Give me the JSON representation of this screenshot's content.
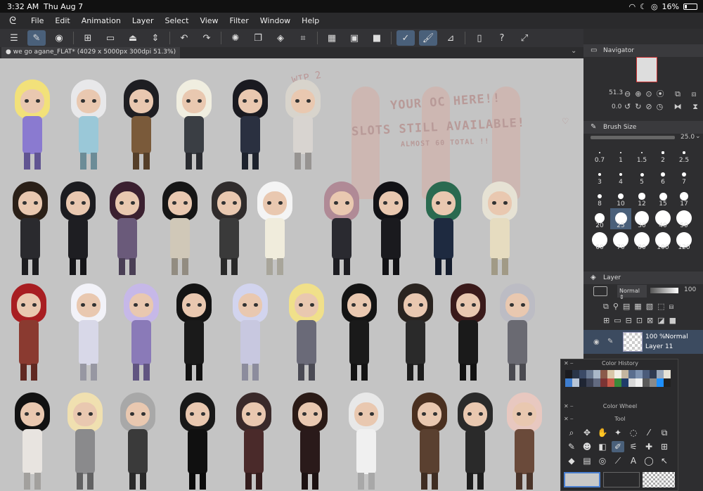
{
  "status": {
    "time": "3:32 AM",
    "date": "Thu Aug 7",
    "battery": "16%"
  },
  "menu": {
    "items": [
      "File",
      "Edit",
      "Animation",
      "Layer",
      "Select",
      "View",
      "Filter",
      "Window",
      "Help"
    ]
  },
  "document": {
    "tab_title": "we go agane_FLAT* (4029 x 5000px 300dpi 51.3%)"
  },
  "canvas_text": {
    "wip": "WIP 2",
    "line1": "YOUR OC HERE!!",
    "line2": "SLOTS STILL AVAILABLE!",
    "line3": "ALMOST 60 TOTAL !!"
  },
  "navigator": {
    "title": "Navigator",
    "zoom": "51.3",
    "rotation": "0.0"
  },
  "brush": {
    "title": "Brush Size",
    "value": "25.0",
    "sizes": [
      "0.7",
      "1",
      "1.5",
      "2",
      "2.5",
      "3",
      "4",
      "5",
      "6",
      "7",
      "8",
      "10",
      "12",
      "15",
      "17",
      "20",
      "25",
      "30",
      "40",
      "50",
      "60",
      "70",
      "80",
      "100",
      "120"
    ],
    "selected": "25"
  },
  "layer": {
    "title": "Layer",
    "blend": "Normal",
    "opacity": "100",
    "row_opacity": "100 %",
    "row_blend": "Normal",
    "row_name": "Layer 11"
  },
  "float": {
    "color_history": "Color History",
    "color_wheel": "Color Wheel",
    "tool": "Tool"
  },
  "colors": {
    "history": [
      "#1b1b1f",
      "#2a3548",
      "#3b4a66",
      "#6b7a92",
      "#aab8c8",
      "#8b5a4a",
      "#d9c7a8",
      "#f2efe6",
      "#c4b6a0",
      "#5a6e8e",
      "#7d92b0",
      "#4b5c7a",
      "#2e3a52",
      "#9aa8bc",
      "#e7e2d6",
      "#3e7ed0",
      "#b9c5d6",
      "#1f2533",
      "#3c4254",
      "#626a80",
      "#7c3434",
      "#c75a4a",
      "#3a8a3a",
      "#1f3b6a",
      "#d8d8d8",
      "#f0f0f0",
      "#5a5a5a",
      "#8a8a8a",
      "#1e90ff",
      "#222222"
    ],
    "accent": "#4a607a"
  }
}
